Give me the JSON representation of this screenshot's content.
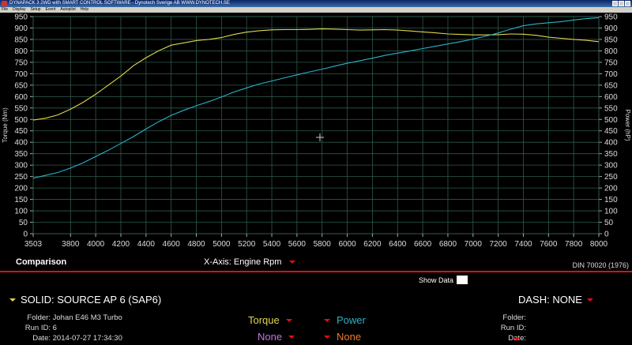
{
  "window": {
    "title": "DYNAPACK 3 2WD with SMART CONTROL SOFTWARE - Dynotech Sverige AB     WWW.DYNOTECH.SE"
  },
  "menu": {
    "items": [
      "File",
      "Display",
      "Setup",
      "Event",
      "Autopilot",
      "Help"
    ]
  },
  "colors": {
    "torque": "#e0d64a",
    "power": "#2ab3c8",
    "grid": "#2d5a4a",
    "accent_red": "#e01010",
    "none_left": "#c870e6",
    "none_right": "#f07a2a"
  },
  "chart_data": {
    "type": "line",
    "x_ticks": [
      "3503",
      "3800",
      "4000",
      "4200",
      "4400",
      "4600",
      "4800",
      "5000",
      "5200",
      "5400",
      "5600",
      "5800",
      "6000",
      "6200",
      "6400",
      "6600",
      "6800",
      "7000",
      "7200",
      "7400",
      "7600",
      "7800",
      "8000"
    ],
    "xlim": [
      3503,
      8000
    ],
    "ylabel_left": "Torque (Nm)",
    "ylabel_right": "Power (hP)",
    "ylim": [
      0,
      950
    ],
    "y_ticks": [
      "0",
      "50",
      "100",
      "150",
      "200",
      "250",
      "300",
      "350",
      "400",
      "450",
      "500",
      "550",
      "600",
      "650",
      "700",
      "750",
      "800",
      "850",
      "900",
      "950"
    ],
    "series": [
      {
        "name": "Torque",
        "color": "#e0d64a",
        "x": [
          3503,
          3600,
          3700,
          3800,
          3900,
          4000,
          4100,
          4200,
          4300,
          4400,
          4500,
          4600,
          4700,
          4800,
          4900,
          5000,
          5100,
          5200,
          5300,
          5400,
          5500,
          5600,
          5700,
          5800,
          5900,
          6000,
          6100,
          6200,
          6300,
          6400,
          6500,
          6600,
          6700,
          6800,
          6900,
          7000,
          7100,
          7200,
          7300,
          7400,
          7500,
          7600,
          7700,
          7800,
          7900,
          8000
        ],
        "values": [
          497,
          505,
          520,
          545,
          575,
          610,
          650,
          690,
          735,
          770,
          800,
          825,
          835,
          845,
          850,
          858,
          872,
          882,
          888,
          892,
          893,
          893,
          894,
          896,
          895,
          893,
          891,
          892,
          893,
          891,
          887,
          883,
          879,
          874,
          872,
          870,
          870,
          871,
          874,
          873,
          868,
          860,
          855,
          850,
          846,
          840
        ]
      },
      {
        "name": "Power",
        "color": "#2ab3c8",
        "x": [
          3503,
          3600,
          3700,
          3800,
          3900,
          4000,
          4100,
          4200,
          4300,
          4400,
          4500,
          4600,
          4700,
          4800,
          4900,
          5000,
          5100,
          5200,
          5300,
          5400,
          5500,
          5600,
          5700,
          5800,
          5900,
          6000,
          6100,
          6200,
          6300,
          6400,
          6500,
          6600,
          6700,
          6800,
          6900,
          7000,
          7100,
          7200,
          7300,
          7400,
          7500,
          7600,
          7700,
          7800,
          7900,
          8000
        ],
        "values": [
          243,
          255,
          268,
          287,
          310,
          338,
          365,
          395,
          425,
          458,
          490,
          518,
          540,
          560,
          578,
          598,
          620,
          638,
          655,
          668,
          682,
          695,
          708,
          720,
          733,
          746,
          757,
          768,
          780,
          790,
          800,
          810,
          820,
          830,
          840,
          852,
          864,
          878,
          895,
          910,
          918,
          923,
          928,
          935,
          941,
          945
        ]
      }
    ],
    "grid": true
  },
  "bottom": {
    "comparison_label": "Comparison",
    "x_axis_label": "X-Axis: Engine Rpm",
    "standard": "DIN 70020 (1976)",
    "show_data_label": "Show Data",
    "solid_label": "SOLID: SOURCE AP 6 (SAP6)",
    "dash_label": "DASH: NONE",
    "left_info": [
      {
        "key": "Folder:",
        "value": "Johan E46 M3 Turbo"
      },
      {
        "key": "Run ID:",
        "value": "6"
      },
      {
        "key": "Date:",
        "value": "2014-07-27 17:34:30"
      }
    ],
    "right_info": [
      {
        "key": "Folder:"
      },
      {
        "key": "Run ID:"
      },
      {
        "key": "Date:"
      }
    ],
    "channels": {
      "ch1": "Torque",
      "ch2": "Power",
      "ch3": "None",
      "ch4": "None"
    }
  }
}
